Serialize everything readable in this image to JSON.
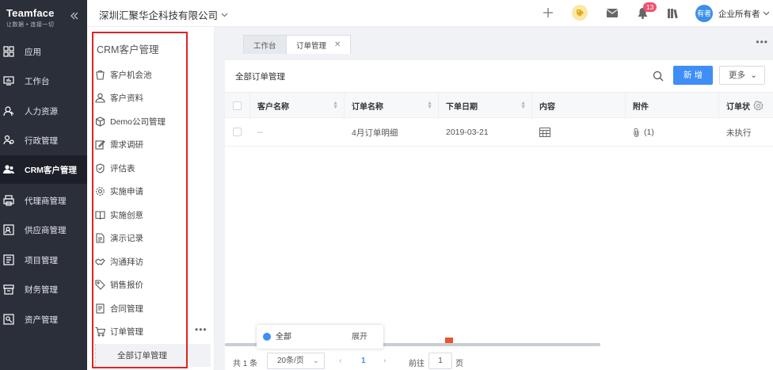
{
  "app": {
    "title": "Teamface",
    "subtitle": "让数据 • 连接一切"
  },
  "nav": [
    {
      "label": "应用",
      "icon": "apps-icon"
    },
    {
      "label": "工作台",
      "icon": "monitor-icon"
    },
    {
      "label": "人力资源",
      "icon": "person-icon"
    },
    {
      "label": "行政管理",
      "icon": "org-icon"
    },
    {
      "label": "CRM客户管理",
      "icon": "users-icon",
      "active": true
    },
    {
      "label": "代理商管理",
      "icon": "printer-icon"
    },
    {
      "label": "供应商管理",
      "icon": "card-icon"
    },
    {
      "label": "项目管理",
      "icon": "project-icon"
    },
    {
      "label": "财务管理",
      "icon": "finance-icon"
    },
    {
      "label": "资产管理",
      "icon": "asset-icon"
    }
  ],
  "header": {
    "company": "深圳汇聚华企科技有限公司",
    "notification_count": "13",
    "avatar_text": "有者",
    "user_label": "企业所有者"
  },
  "panel": {
    "title": "CRM客户管理",
    "items": [
      {
        "label": "客户机会池",
        "icon": "bucket-icon"
      },
      {
        "label": "客户资料",
        "icon": "user-icon"
      },
      {
        "label": "Demo公司管理",
        "icon": "box-icon"
      },
      {
        "label": "需求调研",
        "icon": "edit-icon"
      },
      {
        "label": "评估表",
        "icon": "shield-icon"
      },
      {
        "label": "实施申请",
        "icon": "gear-icon"
      },
      {
        "label": "实施创意",
        "icon": "book-icon"
      },
      {
        "label": "演示记录",
        "icon": "document-icon"
      },
      {
        "label": "沟通拜访",
        "icon": "handshake-icon"
      },
      {
        "label": "销售报价",
        "icon": "tag-icon"
      },
      {
        "label": "合同管理",
        "icon": "contract-icon"
      },
      {
        "label": "订单管理",
        "icon": "cart-icon"
      }
    ],
    "sub_item": "全部订单管理"
  },
  "tabs": [
    {
      "label": "工作台"
    },
    {
      "label": "订单管理",
      "closable": true
    }
  ],
  "list": {
    "title": "全部订单管理",
    "new_label": "新 增",
    "more_label": "更多",
    "columns": [
      "客户名称",
      "订单名称",
      "下单日期",
      "内容",
      "附件",
      "订单状"
    ],
    "rows": [
      {
        "customer": "--",
        "name": "4月订单明细",
        "date": "2019-03-21",
        "attachment": "(1)",
        "status": "未执行"
      }
    ]
  },
  "pager": {
    "total": "共 1 条",
    "page_size": "20条/页",
    "current_page": "1",
    "goto_label": "前往",
    "goto_value": "1",
    "page_unit": "页"
  },
  "popup": {
    "left": "全部",
    "right": "展开"
  },
  "colors": {
    "nav_bg": "#2b2f3a",
    "accent": "#3e8ef7",
    "highlight_border": "#e02323",
    "badge": "#f0506e"
  }
}
